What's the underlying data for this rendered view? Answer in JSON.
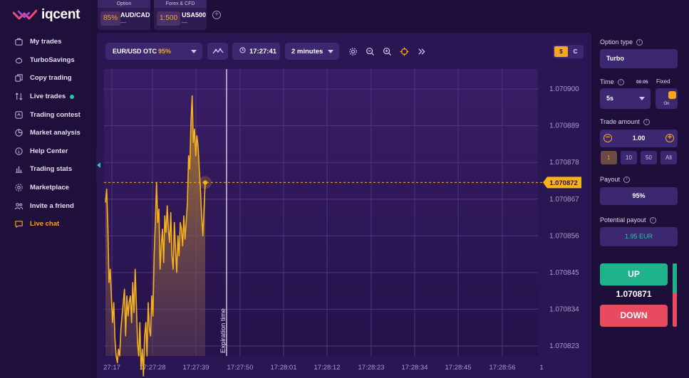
{
  "brand": {
    "name": "iqcent"
  },
  "sidebar": {
    "items": [
      {
        "label": "My trades",
        "icon": "briefcase-icon"
      },
      {
        "label": "TurboSavings",
        "icon": "piggy-bank-icon"
      },
      {
        "label": "Copy trading",
        "icon": "copy-icon"
      },
      {
        "label": "Live trades",
        "icon": "arrows-updown-icon"
      },
      {
        "label": "Trading contest",
        "icon": "trophy-icon"
      },
      {
        "label": "Market analysis",
        "icon": "pie-chart-icon"
      },
      {
        "label": "Help Center",
        "icon": "info-icon"
      },
      {
        "label": "Trading stats",
        "icon": "bar-chart-icon"
      },
      {
        "label": "Marketplace",
        "icon": "gear-icon"
      },
      {
        "label": "Invite a friend",
        "icon": "users-icon"
      },
      {
        "label": "Live chat",
        "icon": "chat-icon",
        "active": true
      }
    ]
  },
  "tabs": [
    {
      "category": "Option",
      "badge": "85%",
      "name": "AUD/CAD",
      "sub": "—"
    },
    {
      "category": "Forex & CFD",
      "badge": "1:500",
      "name": "USA500",
      "sub": "—"
    }
  ],
  "toolbar": {
    "asset": "EUR/USD OTC",
    "asset_payout": "95%",
    "clock": "17:27:41",
    "duration": "2 minutes",
    "currency_on": "$",
    "currency_off": "C"
  },
  "chart_data": {
    "type": "area",
    "y_ticks": [
      "1.070900",
      "1.070889",
      "1.070878",
      "1.070867",
      "1.070856",
      "1.070845",
      "1.070834",
      "1.070823"
    ],
    "x_ticks": [
      "27:17",
      "17:27:28",
      "17:27:39",
      "17:27:50",
      "17:28:01",
      "17:28:12",
      "17:28:23",
      "17:28:34",
      "17:28:45",
      "17:28:56",
      "1"
    ],
    "current_price_label": "1.070872",
    "expiration_label": "Expiration time",
    "ylim": [
      1.07082,
      1.070906
    ],
    "grid": true,
    "series_color": "#f5b21c",
    "values": [
      1.070866,
      1.07087,
      1.07086,
      1.070842,
      1.070846,
      1.070838,
      1.07083,
      1.070836,
      1.070825,
      1.07082,
      1.070818,
      1.070822,
      1.07082,
      1.070828,
      1.070832,
      1.070836,
      1.07084,
      1.070826,
      1.070838,
      1.070832,
      1.070836,
      1.070838,
      1.07083,
      1.070842,
      1.070833,
      1.070846,
      1.070836,
      1.070824,
      1.07082,
      1.07083,
      1.070816,
      1.070822,
      1.070814,
      1.070826,
      1.07083,
      1.07082,
      1.070836,
      1.070828,
      1.070826,
      1.070838,
      1.070832,
      1.07085,
      1.07086,
      1.070872,
      1.07086,
      1.070864,
      1.070846,
      1.070853,
      1.070858,
      1.070848,
      1.070862,
      1.070857,
      1.070865,
      1.070858,
      1.070854,
      1.070863,
      1.07085,
      1.070846,
      1.07086,
      1.070852,
      1.070845,
      1.070856,
      1.07085,
      1.07086,
      1.070858,
      1.070853,
      1.070862,
      1.070855,
      1.07086,
      1.070866,
      1.07088,
      1.070876,
      1.07089,
      1.070898,
      1.070884,
      1.070888,
      1.07088,
      1.070886,
      1.070883,
      1.070876,
      1.07087,
      1.070862,
      1.070856,
      1.070864,
      1.070872
    ]
  },
  "right_panel": {
    "option_type_label": "Option type",
    "option_type": "Turbo",
    "time_label": "Time",
    "time_timer": "00:05",
    "fixed_label": "Fixed",
    "fixed_state": "On",
    "time_value": "5s",
    "trade_amount_label": "Trade amount",
    "trade_amount": "1.00",
    "presets": [
      "1",
      "10",
      "50",
      "All"
    ],
    "payout_label": "Payout",
    "payout": "95%",
    "potential_label": "Potential payout",
    "potential": "1.95 EUR",
    "up_label": "UP",
    "down_label": "DOWN",
    "current_price": "1.070871",
    "sentiment_up_fraction": 0.46
  }
}
